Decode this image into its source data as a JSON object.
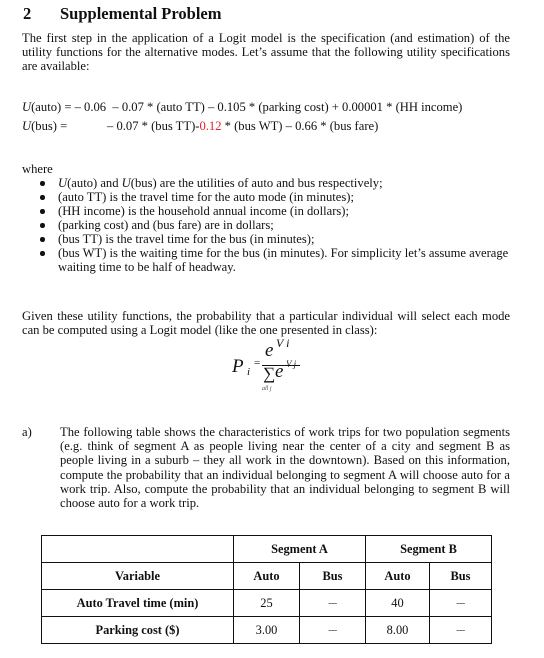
{
  "section": {
    "number": "2",
    "title": "Supplemental Problem"
  },
  "intro": "The first step in the application of a Logit model is the specification (and estimation) of the utility functions for the alternative modes. Let’s assume that the following utility specifications are available:",
  "equations": {
    "auto": {
      "lhs_fn": "U",
      "lhs_arg": "(auto)",
      "eq": " = ",
      "rhs": "– 0.06  – 0.07 * (auto TT) – 0.105 * (parking cost) + 0.00001 * (HH income)"
    },
    "bus": {
      "lhs_fn": "U",
      "lhs_arg": "(bus)",
      "eq": " = ",
      "rhs_part1": "– 0.07 * (bus TT)-",
      "rhs_highlight": "0.12",
      "rhs_part2": " * (bus WT) – 0.66 * (bus fare)",
      "highlight_color": "#e0202a"
    }
  },
  "where_label": "where",
  "definitions": [
    {
      "pre_it": "U",
      "a": "(auto) and ",
      "mid_it": "U",
      "b": "(bus) are the utilities of auto and bus respectively;"
    },
    {
      "text": "(auto TT) is the travel time for the auto mode (in minutes);"
    },
    {
      "text": "(HH income) is the household annual income (in dollars);"
    },
    {
      "text": "(parking cost) and (bus fare) are in dollars;"
    },
    {
      "text": "(bus TT) is the travel time for the bus (in minutes);"
    },
    {
      "text": "(bus WT) is the waiting time for the bus (in minutes). For simplicity let’s assume average waiting time to be half of headway."
    }
  ],
  "logit_intro": "Given these utility functions, the probability that a particular individual will select each mode can be computed using a Logit model (like the one presented in class):",
  "formula": {
    "lhs": "P",
    "lhs_sub": "i",
    "equals": "=",
    "numerator": "e",
    "numerator_sup": "V i",
    "sigma": "∑",
    "denominator": "e",
    "denominator_sup": "V j",
    "sum_under": "all j"
  },
  "part_a": {
    "label": "a)",
    "text": "The following table shows the characteristics of work trips for two population segments (e.g. think of segment A as people living near the center of a city and segment B as people living in a suburb – they all work in the downtown). Based on this information, compute the probability that an individual belonging to segment A will choose auto for a work trip. Also, compute the probability that an individual belonging to segment B will choose auto for a work trip."
  },
  "table": {
    "segments": [
      "Segment A",
      "Segment B"
    ],
    "header": [
      "Variable",
      "Auto",
      "Bus",
      "Auto",
      "Bus"
    ],
    "rows": [
      [
        "Auto Travel time (min)",
        "25",
        "---",
        "40",
        "---"
      ],
      [
        "Parking cost ($)",
        "3.00",
        "---",
        "8.00",
        "---"
      ]
    ]
  }
}
